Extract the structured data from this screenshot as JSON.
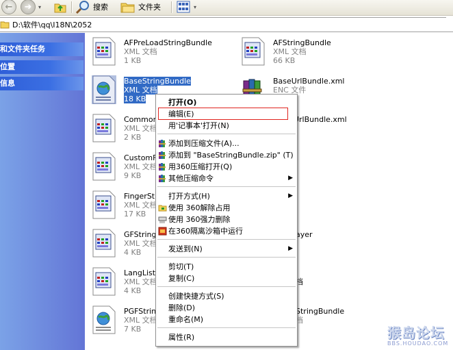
{
  "toolbar": {
    "search_label": "搜索",
    "folders_label": "文件夹"
  },
  "address": {
    "path": "D:\\软件\\qq\\I18N\\2052"
  },
  "sidebar": {
    "headers": [
      "和文件夹任务",
      "位置",
      "信息"
    ]
  },
  "files": [
    {
      "name": "AFPreLoadStringBundle",
      "type": "XML 文档",
      "size": "1 KB",
      "icon": "xml-doc-icon"
    },
    {
      "name": "AFStringBundle",
      "type": "XML 文档",
      "size": "66 KB",
      "icon": "xml-doc-icon"
    },
    {
      "name": "BaseStringBundle",
      "type": "XML 文档",
      "size": "18 KB",
      "icon": "xml-globe-icon"
    },
    {
      "name": "BaseUrlBundle.xml",
      "type": "ENC 文件",
      "size": "",
      "icon": "winrar-icon"
    },
    {
      "name": "CommonS",
      "type": "XML 文档",
      "size": "2 KB",
      "icon": "xml-doc-icon"
    },
    {
      "name": "nUrlBundle.xml",
      "type": "",
      "size": "",
      "icon": "none"
    },
    {
      "name": "CustomFa",
      "type": "XML 文档",
      "size": "9 KB",
      "icon": "xml-doc-icon"
    },
    {
      "name": "FingerStri",
      "type": "XML 文档",
      "size": "17 KB",
      "icon": "xml-doc-icon"
    },
    {
      "name": "GFStringB",
      "type": "XML 文档",
      "size": "4 KB",
      "icon": "xml-doc-icon"
    },
    {
      "name": "ayer",
      "type": "",
      "size": "",
      "icon": "none"
    },
    {
      "name": "LangList",
      "type": "XML 文档",
      "size": "4 KB",
      "icon": "xml-doc-icon"
    },
    {
      "name": "档",
      "type": "",
      "size": "",
      "icon": "none"
    },
    {
      "name": "PGFString",
      "type": "XML 文档",
      "size": "7 KB",
      "icon": "xml-globe-icon"
    },
    {
      "name": "StringBundle",
      "type": "档",
      "size": "",
      "icon": "none"
    }
  ],
  "context_menu": {
    "items": [
      {
        "label": "打开(O)",
        "bold": true
      },
      {
        "label": "编辑(E)"
      },
      {
        "label": "用'记事本'打开(N)"
      },
      {
        "label": "添加到压缩文件(A)...",
        "icon": "winrar-icon"
      },
      {
        "label": "添加到 \"BaseStringBundle.zip\" (T)",
        "icon": "winrar-icon"
      },
      {
        "label": "用360压缩打开(Q)",
        "icon": "winrar-icon"
      },
      {
        "label": "其他压缩命令",
        "icon": "winrar-icon",
        "submenu": true
      },
      {
        "label": "打开方式(H)",
        "submenu": true
      },
      {
        "label": "使用 360解除占用",
        "icon": "unlock-folder-icon"
      },
      {
        "label": "使用 360强力删除",
        "icon": "shred-icon"
      },
      {
        "label": "在360隔离沙箱中运行",
        "icon": "sandbox-icon"
      },
      {
        "label": "发送到(N)",
        "submenu": true
      },
      {
        "label": "剪切(T)"
      },
      {
        "label": "复制(C)"
      },
      {
        "label": "创建快捷方式(S)"
      },
      {
        "label": "删除(D)"
      },
      {
        "label": "重命名(M)"
      },
      {
        "label": "属性(R)"
      }
    ]
  },
  "watermark": {
    "title": "猴岛论坛",
    "url": "BBS.HOUDAO.COM"
  }
}
